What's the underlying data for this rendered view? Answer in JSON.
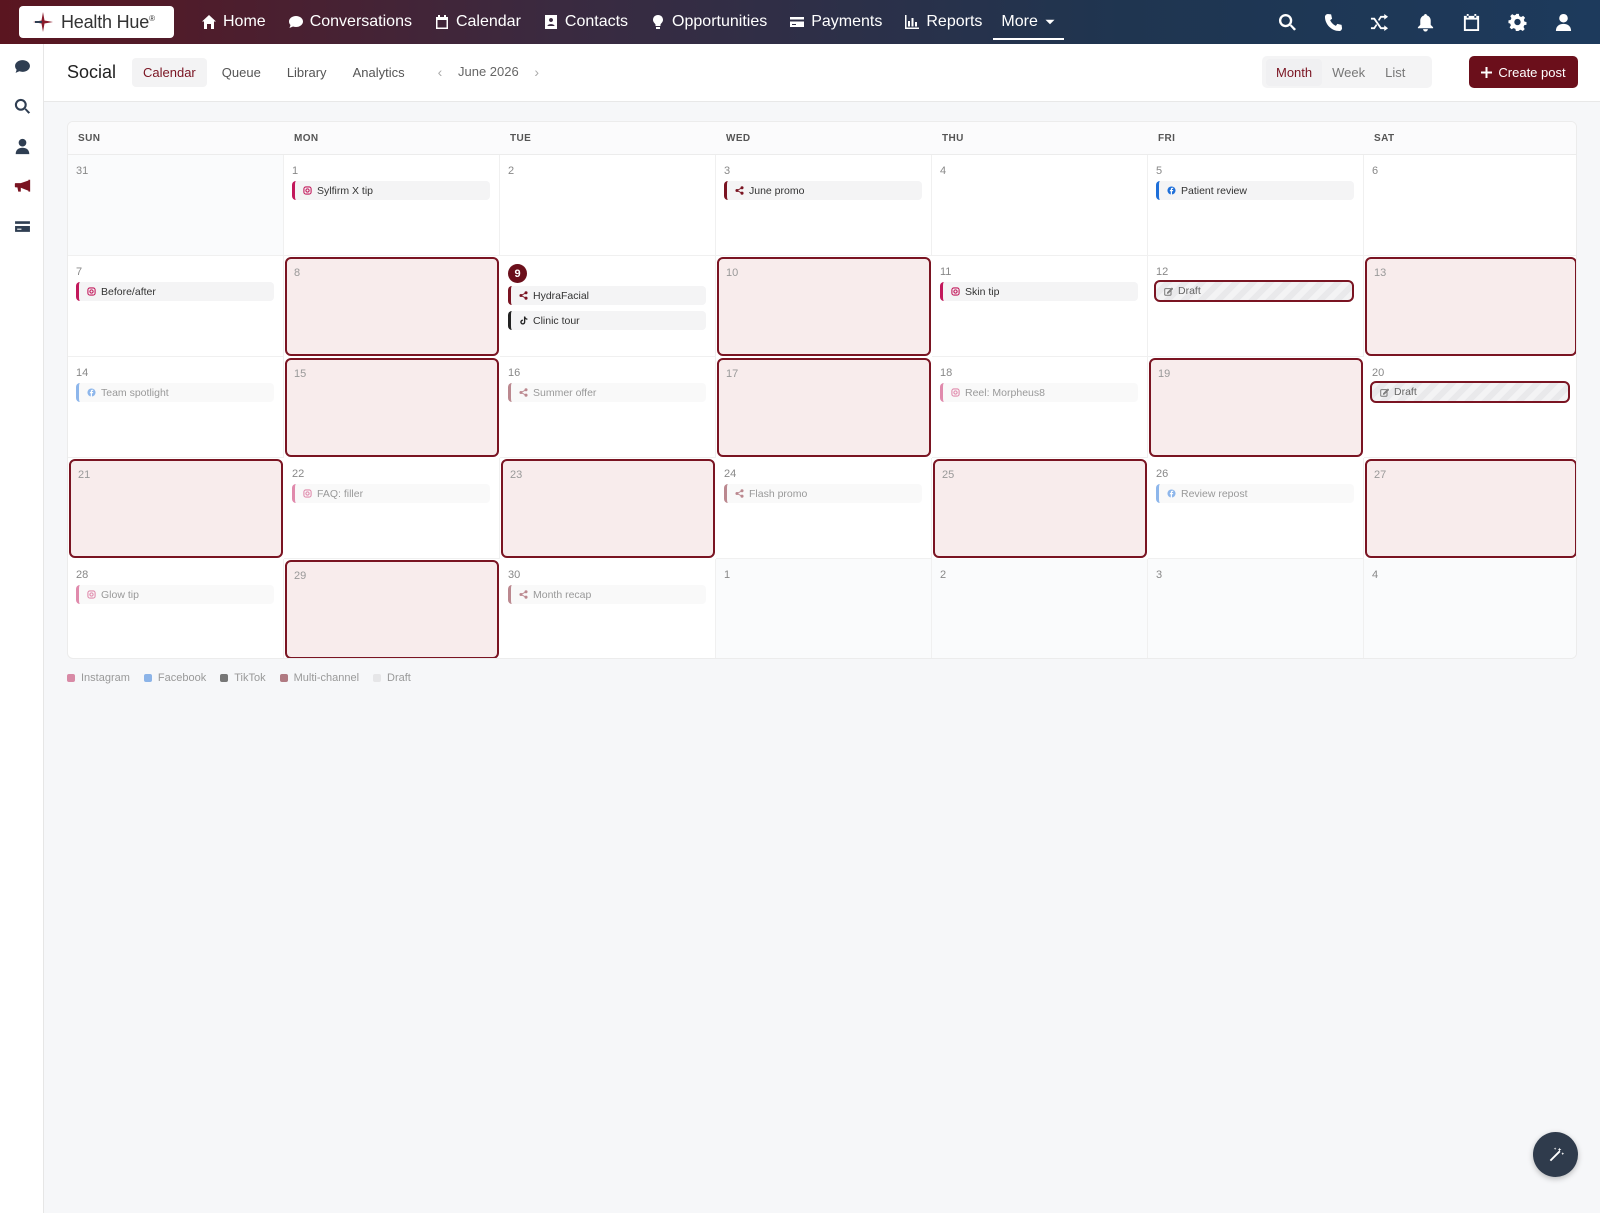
{
  "brand": {
    "name": "Health Hue",
    "mark": "®"
  },
  "nav": {
    "items": [
      {
        "label": "Home",
        "icon": "home-icon"
      },
      {
        "label": "Conversations",
        "icon": "chat-icon"
      },
      {
        "label": "Calendar",
        "icon": "calendar-icon"
      },
      {
        "label": "Contacts",
        "icon": "contact-card-icon"
      },
      {
        "label": "Opportunities",
        "icon": "lightbulb-icon"
      },
      {
        "label": "Payments",
        "icon": "credit-card-icon"
      },
      {
        "label": "Reports",
        "icon": "bar-chart-icon"
      },
      {
        "label": "More",
        "icon": "chevron-down-icon"
      }
    ],
    "right_icons": [
      "search-icon",
      "phone-icon",
      "shuffle-icon",
      "bell-icon",
      "calendar-icon",
      "gear-icon",
      "user-icon"
    ]
  },
  "rail": {
    "icons": [
      "chat-icon",
      "search-icon",
      "user-icon",
      "megaphone-icon",
      "credit-card-icon"
    ]
  },
  "subheader": {
    "title": "Social",
    "tabs": [
      "Calendar",
      "Queue",
      "Library",
      "Analytics"
    ],
    "active_tab": "Calendar",
    "month_label": "June 2026",
    "views": [
      "Month",
      "Week",
      "List"
    ],
    "active_view": "Month",
    "create_label": "Create post"
  },
  "calendar": {
    "weekdays": [
      "SUN",
      "MON",
      "TUE",
      "WED",
      "THU",
      "FRI",
      "SAT"
    ],
    "weeks": [
      [
        {
          "day": "31",
          "other": true
        },
        {
          "day": "1",
          "posts": [
            {
              "type": "ig",
              "label": "Sylfirm X tip"
            }
          ]
        },
        {
          "day": "2"
        },
        {
          "day": "3",
          "posts": [
            {
              "type": "mc",
              "label": "June promo"
            }
          ]
        },
        {
          "day": "4"
        },
        {
          "day": "5",
          "posts": [
            {
              "type": "fb",
              "label": "Patient review"
            }
          ]
        },
        {
          "day": "6"
        }
      ],
      [
        {
          "day": "7",
          "posts": [
            {
              "type": "ig",
              "label": "Before/after"
            }
          ]
        },
        {
          "day": "8",
          "hl": true
        },
        {
          "day": "9",
          "today": true,
          "posts": [
            {
              "type": "mc",
              "label": "HydraFacial"
            },
            {
              "type": "tt",
              "label": "Clinic tour"
            }
          ]
        },
        {
          "day": "10",
          "hl": true
        },
        {
          "day": "11",
          "posts": [
            {
              "type": "ig",
              "label": "Skin tip"
            }
          ]
        },
        {
          "day": "12",
          "posts": [
            {
              "type": "draft",
              "label": "Draft"
            }
          ]
        },
        {
          "day": "13",
          "hl": true
        }
      ],
      [
        {
          "day": "14",
          "posts": [
            {
              "type": "fb",
              "label": "Team spotlight",
              "faded": true
            }
          ]
        },
        {
          "day": "15",
          "hl": true
        },
        {
          "day": "16",
          "posts": [
            {
              "type": "mc",
              "label": "Summer offer",
              "faded": true
            }
          ]
        },
        {
          "day": "17",
          "hl": true
        },
        {
          "day": "18",
          "posts": [
            {
              "type": "ig",
              "label": "Reel: Morpheus8",
              "faded": true
            }
          ]
        },
        {
          "day": "19",
          "hl": true
        },
        {
          "day": "20",
          "posts": [
            {
              "type": "draft",
              "label": "Draft"
            }
          ]
        }
      ],
      [
        {
          "day": "21",
          "hl": true
        },
        {
          "day": "22",
          "posts": [
            {
              "type": "ig",
              "label": "FAQ: filler",
              "faded": true
            }
          ]
        },
        {
          "day": "23",
          "hl": true
        },
        {
          "day": "24",
          "posts": [
            {
              "type": "mc",
              "label": "Flash promo",
              "faded": true
            }
          ]
        },
        {
          "day": "25",
          "hl": true
        },
        {
          "day": "26",
          "posts": [
            {
              "type": "fb",
              "label": "Review repost",
              "faded": true
            }
          ]
        },
        {
          "day": "27",
          "hl": true
        }
      ],
      [
        {
          "day": "28",
          "posts": [
            {
              "type": "ig",
              "label": "Glow tip",
              "faded": true
            }
          ]
        },
        {
          "day": "29",
          "hl": true
        },
        {
          "day": "30",
          "posts": [
            {
              "type": "mc",
              "label": "Month recap",
              "faded": true
            }
          ]
        },
        {
          "day": "1",
          "other": true
        },
        {
          "day": "2",
          "other": true
        },
        {
          "day": "3",
          "other": true
        },
        {
          "day": "4",
          "other": true
        }
      ]
    ]
  },
  "legend": [
    {
      "label": "Instagram",
      "color": "#d88aa6"
    },
    {
      "label": "Facebook",
      "color": "#8cb4e8"
    },
    {
      "label": "TikTok",
      "color": "#777777"
    },
    {
      "label": "Multi-channel",
      "color": "#b07a82"
    },
    {
      "label": "Draft",
      "color": "#e6e6e8"
    }
  ],
  "colors": {
    "accent": "#6b0f1b",
    "highlight_bg": "#f8ecec"
  }
}
